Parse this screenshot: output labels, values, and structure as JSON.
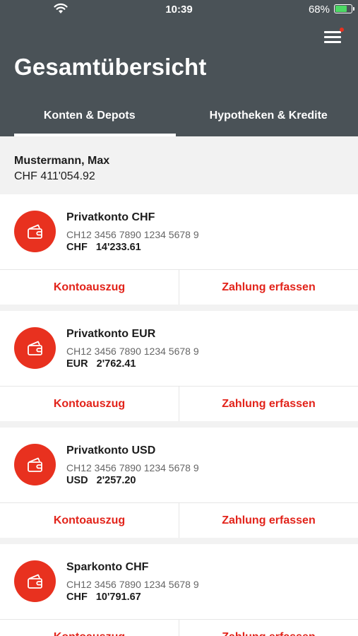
{
  "statusbar": {
    "time": "10:39",
    "battery": "68%",
    "battery_fraction": 0.68
  },
  "header": {
    "title": "Gesamtübersicht",
    "tabs": [
      {
        "label": "Konten & Depots",
        "active": true
      },
      {
        "label": "Hypotheken & Kredite",
        "active": false
      }
    ]
  },
  "owner": {
    "name": "Mustermann, Max",
    "total": "CHF 411'054.92"
  },
  "accounts": [
    {
      "name": "Privatkonto CHF",
      "iban": "CH12 3456 7890 1234 5678 9",
      "currency": "CHF",
      "amount": "14'233.61"
    },
    {
      "name": "Privatkonto EUR",
      "iban": "CH12 3456 7890 1234 5678 9",
      "currency": "EUR",
      "amount": "2'762.41"
    },
    {
      "name": "Privatkonto USD",
      "iban": "CH12 3456 7890 1234 5678 9",
      "currency": "USD",
      "amount": "2'257.20"
    },
    {
      "name": "Sparkonto CHF",
      "iban": "CH12 3456 7890 1234 5678 9",
      "currency": "CHF",
      "amount": "10'791.67"
    }
  ],
  "actions": {
    "statement": "Kontoauszug",
    "payment": "Zahlung erfassen"
  },
  "colors": {
    "header": "#4a5257",
    "accent": "#e8311f",
    "action_text": "#e2231a"
  }
}
